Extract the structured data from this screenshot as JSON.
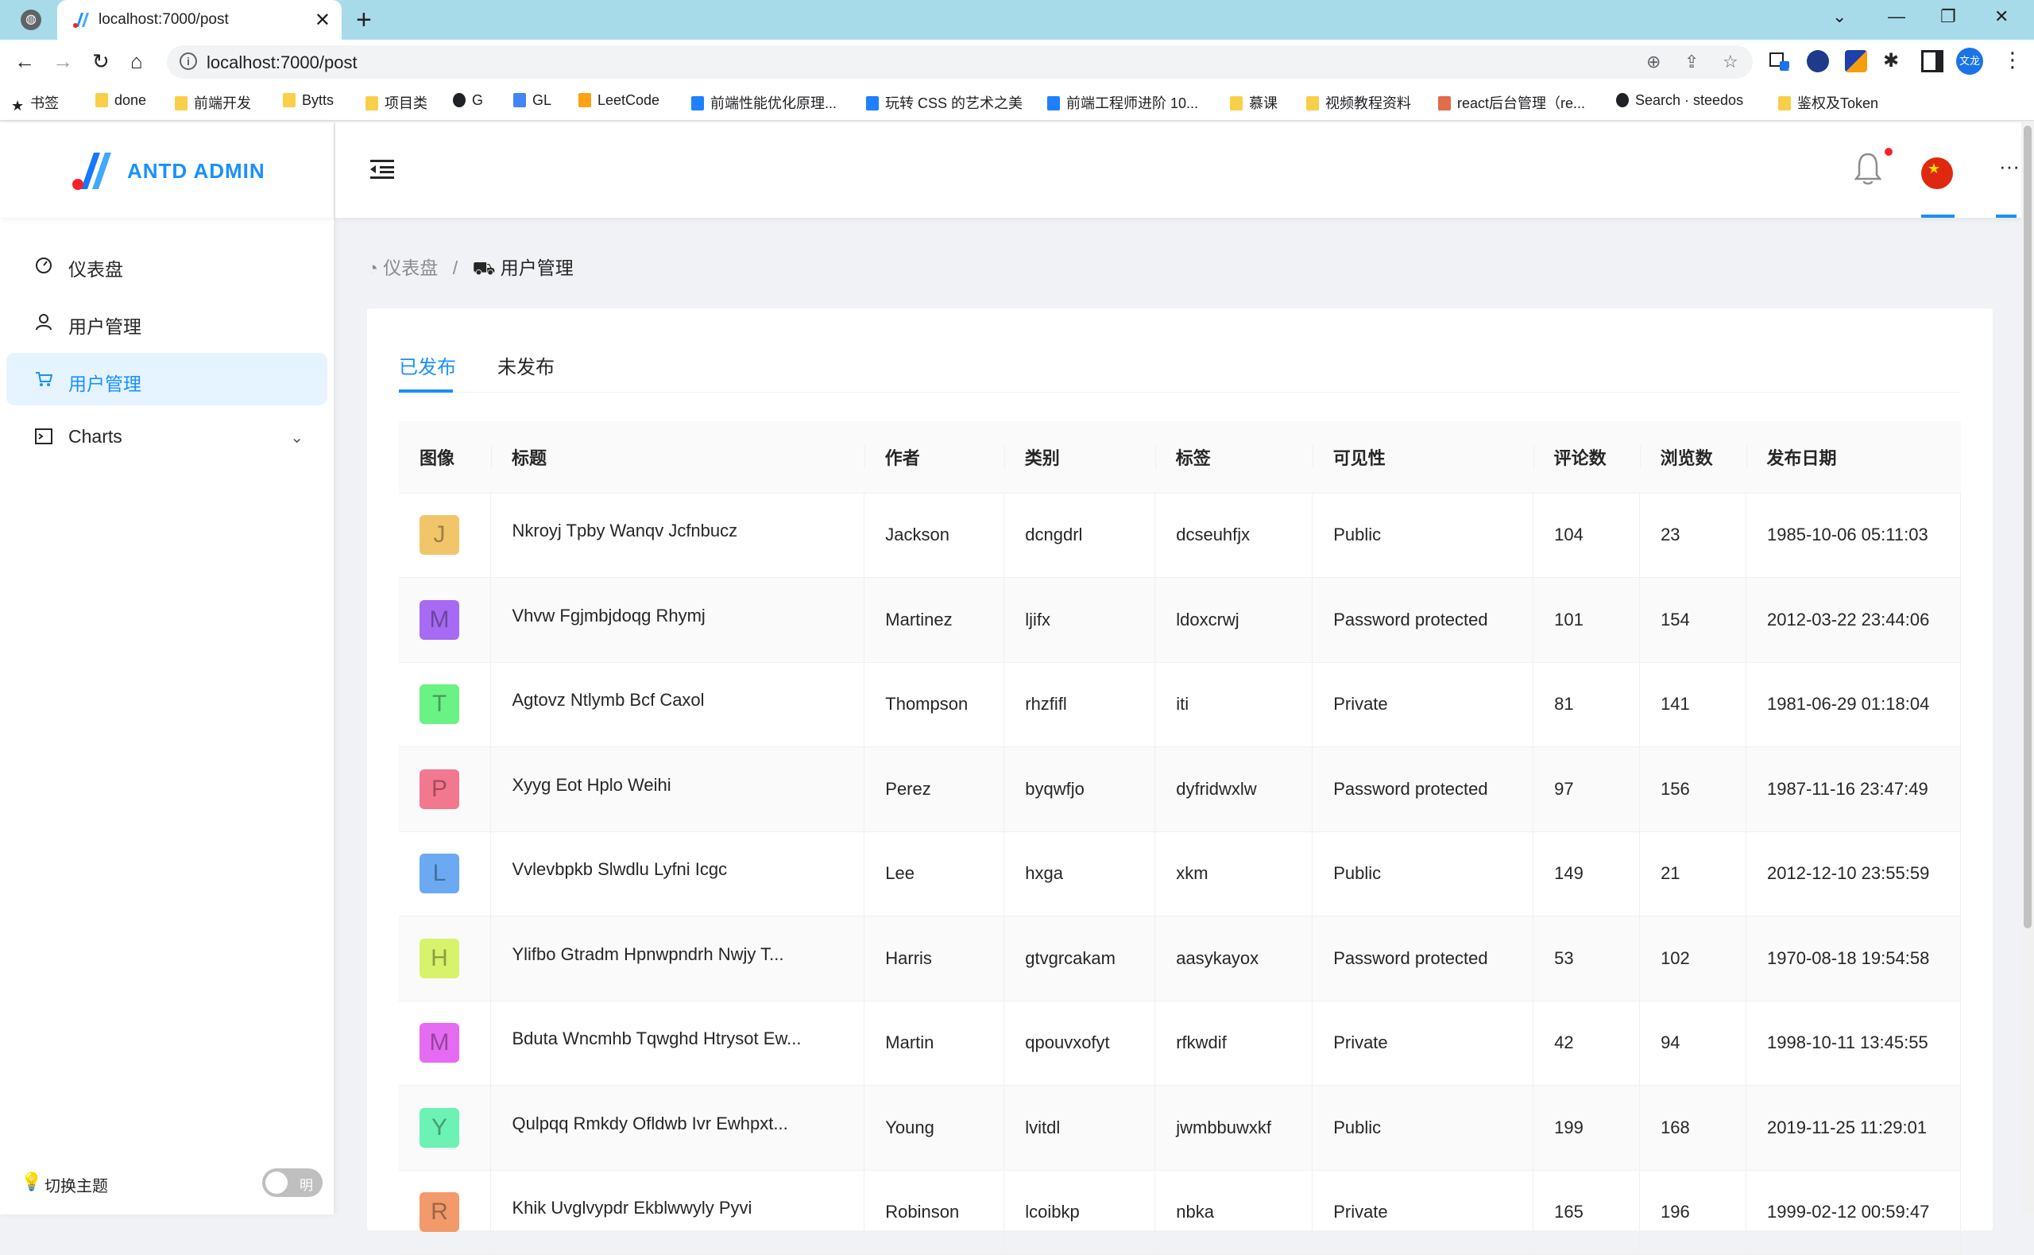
{
  "browser": {
    "tab_title": "localhost:7000/post",
    "url": "localhost:7000/post",
    "bookmarks": [
      {
        "label": "书签",
        "kind": "star"
      },
      {
        "label": "done",
        "kind": "folder"
      },
      {
        "label": "前端开发",
        "kind": "folder"
      },
      {
        "label": "Bytts",
        "kind": "folder"
      },
      {
        "label": "项目类",
        "kind": "folder"
      },
      {
        "label": "G",
        "kind": "github"
      },
      {
        "label": "GL",
        "kind": "google"
      },
      {
        "label": "LeetCode",
        "kind": "leetcode"
      },
      {
        "label": "前端性能优化原理...",
        "kind": "juejin"
      },
      {
        "label": "玩转 CSS 的艺术之美",
        "kind": "juejin"
      },
      {
        "label": "前端工程师进阶 10...",
        "kind": "juejin"
      },
      {
        "label": "慕课",
        "kind": "folder"
      },
      {
        "label": "视频教程资料",
        "kind": "folder"
      },
      {
        "label": "react后台管理（re...",
        "kind": "react"
      },
      {
        "label": "Search · steedos",
        "kind": "github"
      },
      {
        "label": "鉴权及Token",
        "kind": "folder"
      }
    ],
    "profile_label": "文龙",
    "ext_badge": "1"
  },
  "app": {
    "logo_text": "ANTD ADMIN",
    "menu": [
      {
        "label": "仪表盘",
        "icon": "dashboard-icon",
        "active": false
      },
      {
        "label": "用户管理",
        "icon": "user-icon",
        "active": false
      },
      {
        "label": "用户管理",
        "icon": "shopping-cart-icon",
        "active": true
      },
      {
        "label": "Charts",
        "icon": "code-icon",
        "active": false
      }
    ],
    "theme_label": "切换主题",
    "theme_toggle_text": "明"
  },
  "breadcrumb": {
    "home": "仪表盘",
    "sep": "/",
    "current": "用户管理"
  },
  "tabs": [
    {
      "label": "已发布",
      "active": true
    },
    {
      "label": "未发布",
      "active": false
    }
  ],
  "table": {
    "headers": [
      "图像",
      "标题",
      "作者",
      "类别",
      "标签",
      "可见性",
      "评论数",
      "浏览数",
      "发布日期"
    ],
    "rows": [
      {
        "letter": "J",
        "color": "#f2c56b",
        "title": "Nkroyj Tpby Wanqv Jcfnbucz",
        "author": "Jackson",
        "category": "dcngdrl",
        "tags": "dcseuhfjx",
        "visibility": "Public",
        "comments": "104",
        "views": "23",
        "date": "1985-10-06 05:11:03"
      },
      {
        "letter": "M",
        "color": "#a66bf2",
        "title": "Vhvw Fgjmbjdoqg Rhymj",
        "author": "Martinez",
        "category": "ljifx",
        "tags": "ldoxcrwj",
        "visibility": "Password protected",
        "comments": "101",
        "views": "154",
        "date": "2012-03-22 23:44:06"
      },
      {
        "letter": "T",
        "color": "#6bf285",
        "title": "Agtovz Ntlymb Bcf Caxol",
        "author": "Thompson",
        "category": "rhzfifl",
        "tags": "iti",
        "visibility": "Private",
        "comments": "81",
        "views": "141",
        "date": "1981-06-29 01:18:04"
      },
      {
        "letter": "P",
        "color": "#f2788f",
        "title": "Xyyg Eot Hplo Weihi",
        "author": "Perez",
        "category": "byqwfjo",
        "tags": "dyfridwxlw",
        "visibility": "Password protected",
        "comments": "97",
        "views": "156",
        "date": "1987-11-16 23:47:49"
      },
      {
        "letter": "L",
        "color": "#6baaf2",
        "title": "Vvlevbpkb Slwdlu Lyfni Icgc",
        "author": "Lee",
        "category": "hxga",
        "tags": "xkm",
        "visibility": "Public",
        "comments": "149",
        "views": "21",
        "date": "2012-12-10 23:55:59"
      },
      {
        "letter": "H",
        "color": "#d8f26b",
        "title": "Ylifbo Gtradm Hpnwpndrh Nwjy T...",
        "author": "Harris",
        "category": "gtvgrcakam",
        "tags": "aasykayox",
        "visibility": "Password protected",
        "comments": "53",
        "views": "102",
        "date": "1970-08-18 19:54:58"
      },
      {
        "letter": "M",
        "color": "#e46bf2",
        "title": "Bduta Wncmhb Tqwghd Htrysot Ew...",
        "author": "Martin",
        "category": "qpouvxofyt",
        "tags": "rfkwdif",
        "visibility": "Private",
        "comments": "42",
        "views": "94",
        "date": "1998-10-11 13:45:55"
      },
      {
        "letter": "Y",
        "color": "#6bf2b4",
        "title": "Qulpqq Rmkdy Ofldwb Ivr Ewhpxt...",
        "author": "Young",
        "category": "lvitdl",
        "tags": "jwmbbuwxkf",
        "visibility": "Public",
        "comments": "199",
        "views": "168",
        "date": "2019-11-25 11:29:01"
      },
      {
        "letter": "R",
        "color": "#f29a6b",
        "title": "Khik Uvglvypdr Ekblwwyly Pyvi",
        "author": "Robinson",
        "category": "lcoibkp",
        "tags": "nbka",
        "visibility": "Private",
        "comments": "165",
        "views": "196",
        "date": "1999-02-12 00:59:47"
      }
    ]
  }
}
